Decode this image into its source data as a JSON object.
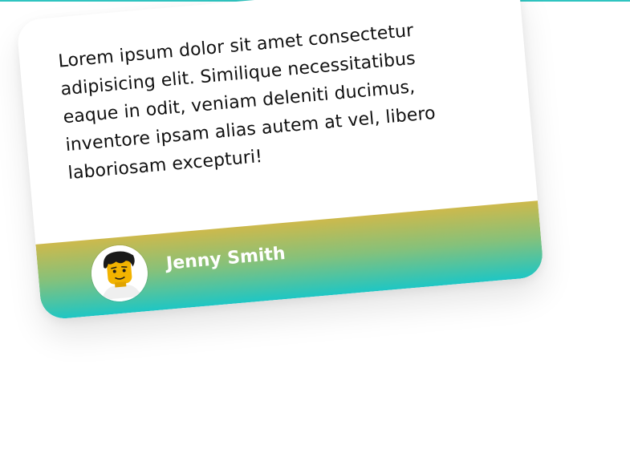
{
  "testimonial": {
    "quote": "Lorem ipsum dolor sit amet consectetur adipisicing elit. Similique necessitatibus eaque in odit, veniam deleniti ducimus, inventore ipsam alias autem at vel, libero laboriosam excepturi!",
    "author": "Jenny Smith",
    "avatar_icon": "lego-minifigure-avatar-icon"
  },
  "colors": {
    "accent_top": "#2fc4c0",
    "gradient_start": "#cdb94c",
    "gradient_mid": "#86c17a",
    "gradient_end": "#1ec6c4",
    "author_text": "#ffffff",
    "quote_text": "#111111"
  }
}
